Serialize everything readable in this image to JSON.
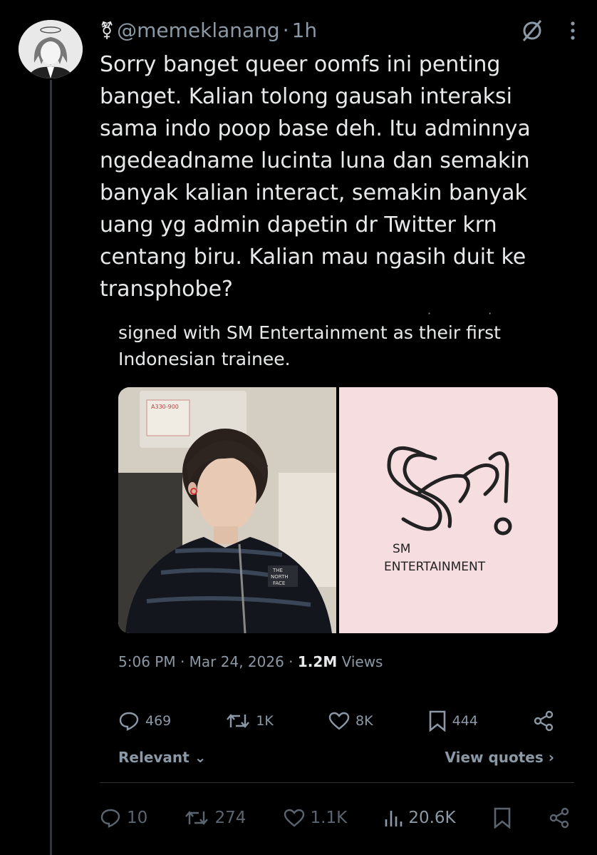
{
  "tweet": {
    "handle": "@memeklanang",
    "separator": "·",
    "time": "1h",
    "text": "Sorry banget queer oomfs ini penting banget. Kalian tolong gausah interaksi sama indo poop base deh. Itu adminnya ngedeadname lucinta luna dan semakin banyak kalian interact, semakin banyak uang yg admin dapetin dr Twitter krn centang biru. Kalian mau ngasih duit ke transphobe?",
    "identity_symbol": "⚧"
  },
  "quote": {
    "text": "signed with SM Entertainment as their first Indonesian trainee.",
    "media": {
      "logo_line1": "SM",
      "logo_line2": "ENTERTAINMENT",
      "jacket_brand_line1": "THE",
      "jacket_brand_line2": "NORTH",
      "jacket_brand_line3": "FACE",
      "photo_sign": "A330-900"
    },
    "timestamp": "5:06 PM · Mar 24, 2026",
    "views_count": "1.2M",
    "views_label": "Views",
    "actions": {
      "replies": "469",
      "reposts": "1K",
      "likes": "8K",
      "bookmarks": "444"
    },
    "sort_label": "Relevant",
    "view_quotes_label": "View quotes"
  },
  "bottom_bar": {
    "replies": "10",
    "reposts": "274",
    "likes": "1.1K",
    "views": "20.6K"
  },
  "colors": {
    "background": "#000000",
    "text": "#e7e9ea",
    "muted": "#8b98a5",
    "logo_panel": "#f5dde0"
  }
}
